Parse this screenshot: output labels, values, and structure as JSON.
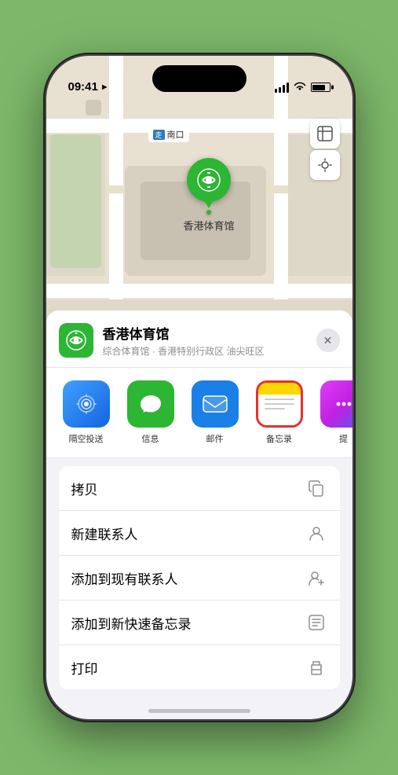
{
  "status": {
    "time": "09:41",
    "location_icon": "▶"
  },
  "map": {
    "label_badge": "走",
    "label_text": "南口",
    "pin_label": "香港体育馆"
  },
  "venue": {
    "name": "香港体育馆",
    "description": "综合体育馆 · 香港特别行政区 油尖旺区"
  },
  "share_actions": [
    {
      "id": "airdrop",
      "label": "隔空投送",
      "type": "airdrop"
    },
    {
      "id": "messages",
      "label": "信息",
      "type": "messages"
    },
    {
      "id": "mail",
      "label": "邮件",
      "type": "mail"
    },
    {
      "id": "notes",
      "label": "备忘录",
      "type": "notes"
    },
    {
      "id": "more",
      "label": "提",
      "type": "more"
    }
  ],
  "menu_items": [
    {
      "id": "copy",
      "label": "拷贝",
      "icon": "copy"
    },
    {
      "id": "new-contact",
      "label": "新建联系人",
      "icon": "person"
    },
    {
      "id": "add-contact",
      "label": "添加到现有联系人",
      "icon": "person-add"
    },
    {
      "id": "quick-note",
      "label": "添加到新快速备忘录",
      "icon": "note"
    },
    {
      "id": "print",
      "label": "打印",
      "icon": "printer"
    }
  ]
}
